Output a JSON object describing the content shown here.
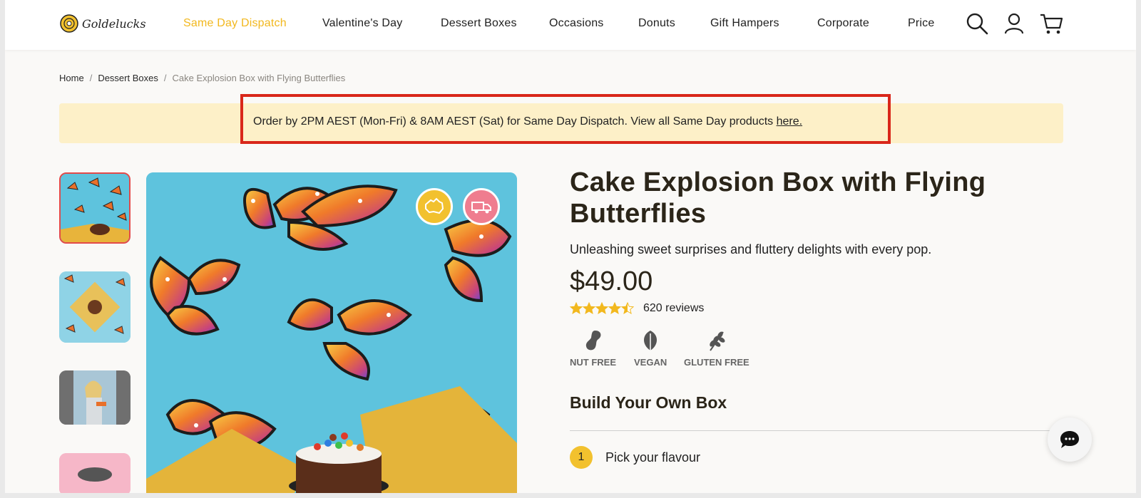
{
  "brand": {
    "name": "Goldelucks"
  },
  "nav": {
    "items": [
      {
        "label": "Same Day Dispatch"
      },
      {
        "label": "Valentine's Day"
      },
      {
        "label": "Dessert Boxes"
      },
      {
        "label": "Occasions"
      },
      {
        "label": "Donuts"
      },
      {
        "label": "Gift Hampers"
      },
      {
        "label": "Corporate"
      },
      {
        "label": "Price"
      }
    ],
    "icons": [
      "search-icon",
      "account-icon",
      "cart-icon"
    ]
  },
  "breadcrumb": {
    "items": [
      "Home",
      "Dessert Boxes",
      "Cake Explosion Box with Flying Butterflies"
    ],
    "separator": "/"
  },
  "banner": {
    "text": "Order by 2PM AEST (Mon-Fri) & 8AM AEST (Sat) for Same Day Dispatch. View all Same Day products ",
    "link_text": "here."
  },
  "product": {
    "title": "Cake Explosion Box with Flying Butterflies",
    "subtitle": "Unleashing sweet surprises and fluttery delights with every pop.",
    "price": "$49.00",
    "rating": 4.5,
    "reviews": "620 reviews",
    "dietary": [
      {
        "label": "NUT FREE",
        "icon": "peanut-icon"
      },
      {
        "label": "VEGAN",
        "icon": "leaf-icon"
      },
      {
        "label": "GLUTEN FREE",
        "icon": "wheat-icon"
      }
    ]
  },
  "builder": {
    "title": "Build Your Own Box",
    "steps": [
      {
        "number": "1",
        "label": "Pick your flavour"
      }
    ]
  },
  "colors": {
    "accent": "#f2b81e",
    "banner_bg": "#fdf0c8",
    "highlight": "#d9271a",
    "image_bg": "#5ec3dd"
  }
}
